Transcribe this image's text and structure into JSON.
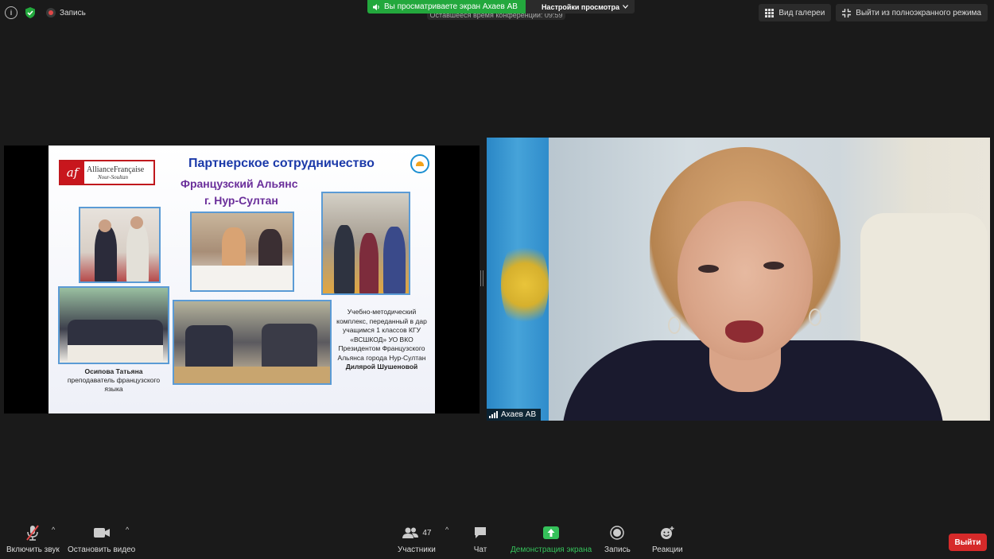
{
  "top_bar": {
    "recording_label": "Запись",
    "share_banner_text": "Вы просматриваете экран Ахаев АВ",
    "view_options_label": "Настройки просмотра",
    "time_left_text": "Оставшееся время конференции: 09:59",
    "gallery_view_label": "Вид галереи",
    "exit_fullscreen_label": "Выйти из полноэкранного режима"
  },
  "slide": {
    "logo_name": "AllianceFrançaise",
    "logo_city": "Nour-Soultan",
    "title": "Партнерское сотрудничество",
    "subtitle_line1": "Французский Альянс",
    "subtitle_line2": "г. Нур-Султан",
    "caption_left_name": "Осипова Татьяна",
    "caption_left_role": "преподаватель французского языка",
    "caption_right_text": "Учебно-методический комплекс, переданный в дар учащимся 1 классов КГУ «ВСШКОД» УО ВКО Президентом Французского Альянса города Нур-Султан",
    "caption_right_name": "Дилярой Шушеновой"
  },
  "video_tile": {
    "participant_name": "Ахаев АВ"
  },
  "toolbar": {
    "unmute_label": "Включить звук",
    "stop_video_label": "Остановить видео",
    "participants_label": "Участники",
    "participants_count": "47",
    "chat_label": "Чат",
    "share_screen_label": "Демонстрация экрана",
    "record_label": "Запись",
    "reactions_label": "Реакции",
    "leave_label": "Выйти"
  },
  "colors": {
    "share_green": "#23a83d",
    "leave_red": "#d62a2a",
    "background": "#1a1a1a"
  }
}
